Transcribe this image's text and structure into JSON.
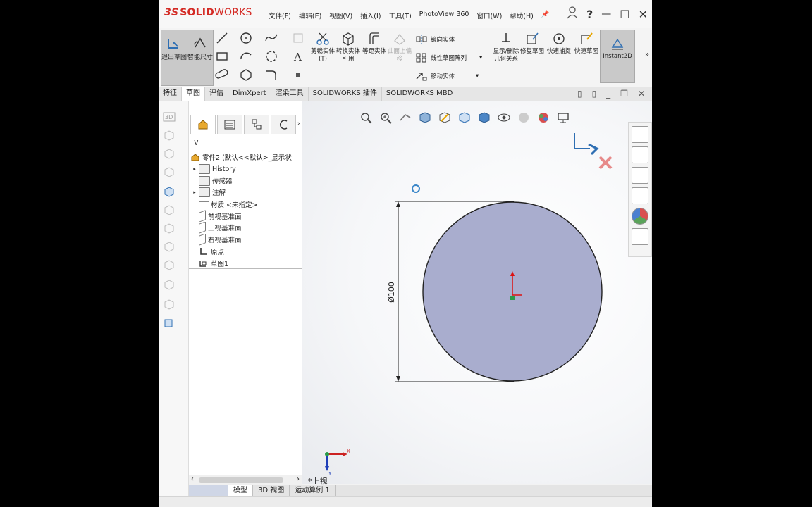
{
  "app": {
    "logo_prefix": "3S",
    "logo_solid": "SOLID",
    "logo_works": "WORKS",
    "menu": [
      "文件(F)",
      "编辑(E)",
      "视图(V)",
      "插入(I)",
      "工具(T)",
      "PhotoView 360",
      "窗口(W)",
      "帮助(H)"
    ],
    "help_label": "?"
  },
  "toolbar": {
    "exit_sketch": "退出草图",
    "smart_dimension": "智能尺寸",
    "trim": "剪裁实体(T)",
    "convert": "转换实体引用",
    "offset": "等距实体",
    "surface_offset": "曲面上偏移",
    "mirror": "镜向实体",
    "linear_pattern": "线性草图阵列",
    "move": "移动实体",
    "display_relations": "显示/删除几何关系",
    "repair": "修复草图",
    "quick_snaps": "快速捕捉",
    "rapid_sketch": "快速草图",
    "instant2d": "Instant2D"
  },
  "tabs": [
    "特征",
    "草图",
    "评估",
    "DimXpert",
    "渲染工具",
    "SOLIDWORKS 插件",
    "SOLIDWORKS MBD"
  ],
  "active_tab": "草图",
  "feature_tree": {
    "root": "零件2 (默认<<默认>_显示状",
    "items": [
      {
        "label": "History",
        "expandable": true
      },
      {
        "label": "传感器",
        "expandable": false
      },
      {
        "label": "注解",
        "expandable": true
      },
      {
        "label": "材质 <未指定>",
        "expandable": false
      },
      {
        "label": "前视基准面",
        "expandable": false
      },
      {
        "label": "上视基准面",
        "expandable": false
      },
      {
        "label": "右视基准面",
        "expandable": false
      },
      {
        "label": "原点",
        "expandable": false
      },
      {
        "label": "草图1",
        "expandable": false
      }
    ]
  },
  "graphics": {
    "dimension_text": "Ø100",
    "view_label": "*上视",
    "triad_x": "X",
    "triad_y": "Y",
    "circle_fill": "#a9adce"
  },
  "bottom_tabs": [
    "模型",
    "3D 视图",
    "运动算例 1"
  ],
  "active_bottom_tab": "模型"
}
